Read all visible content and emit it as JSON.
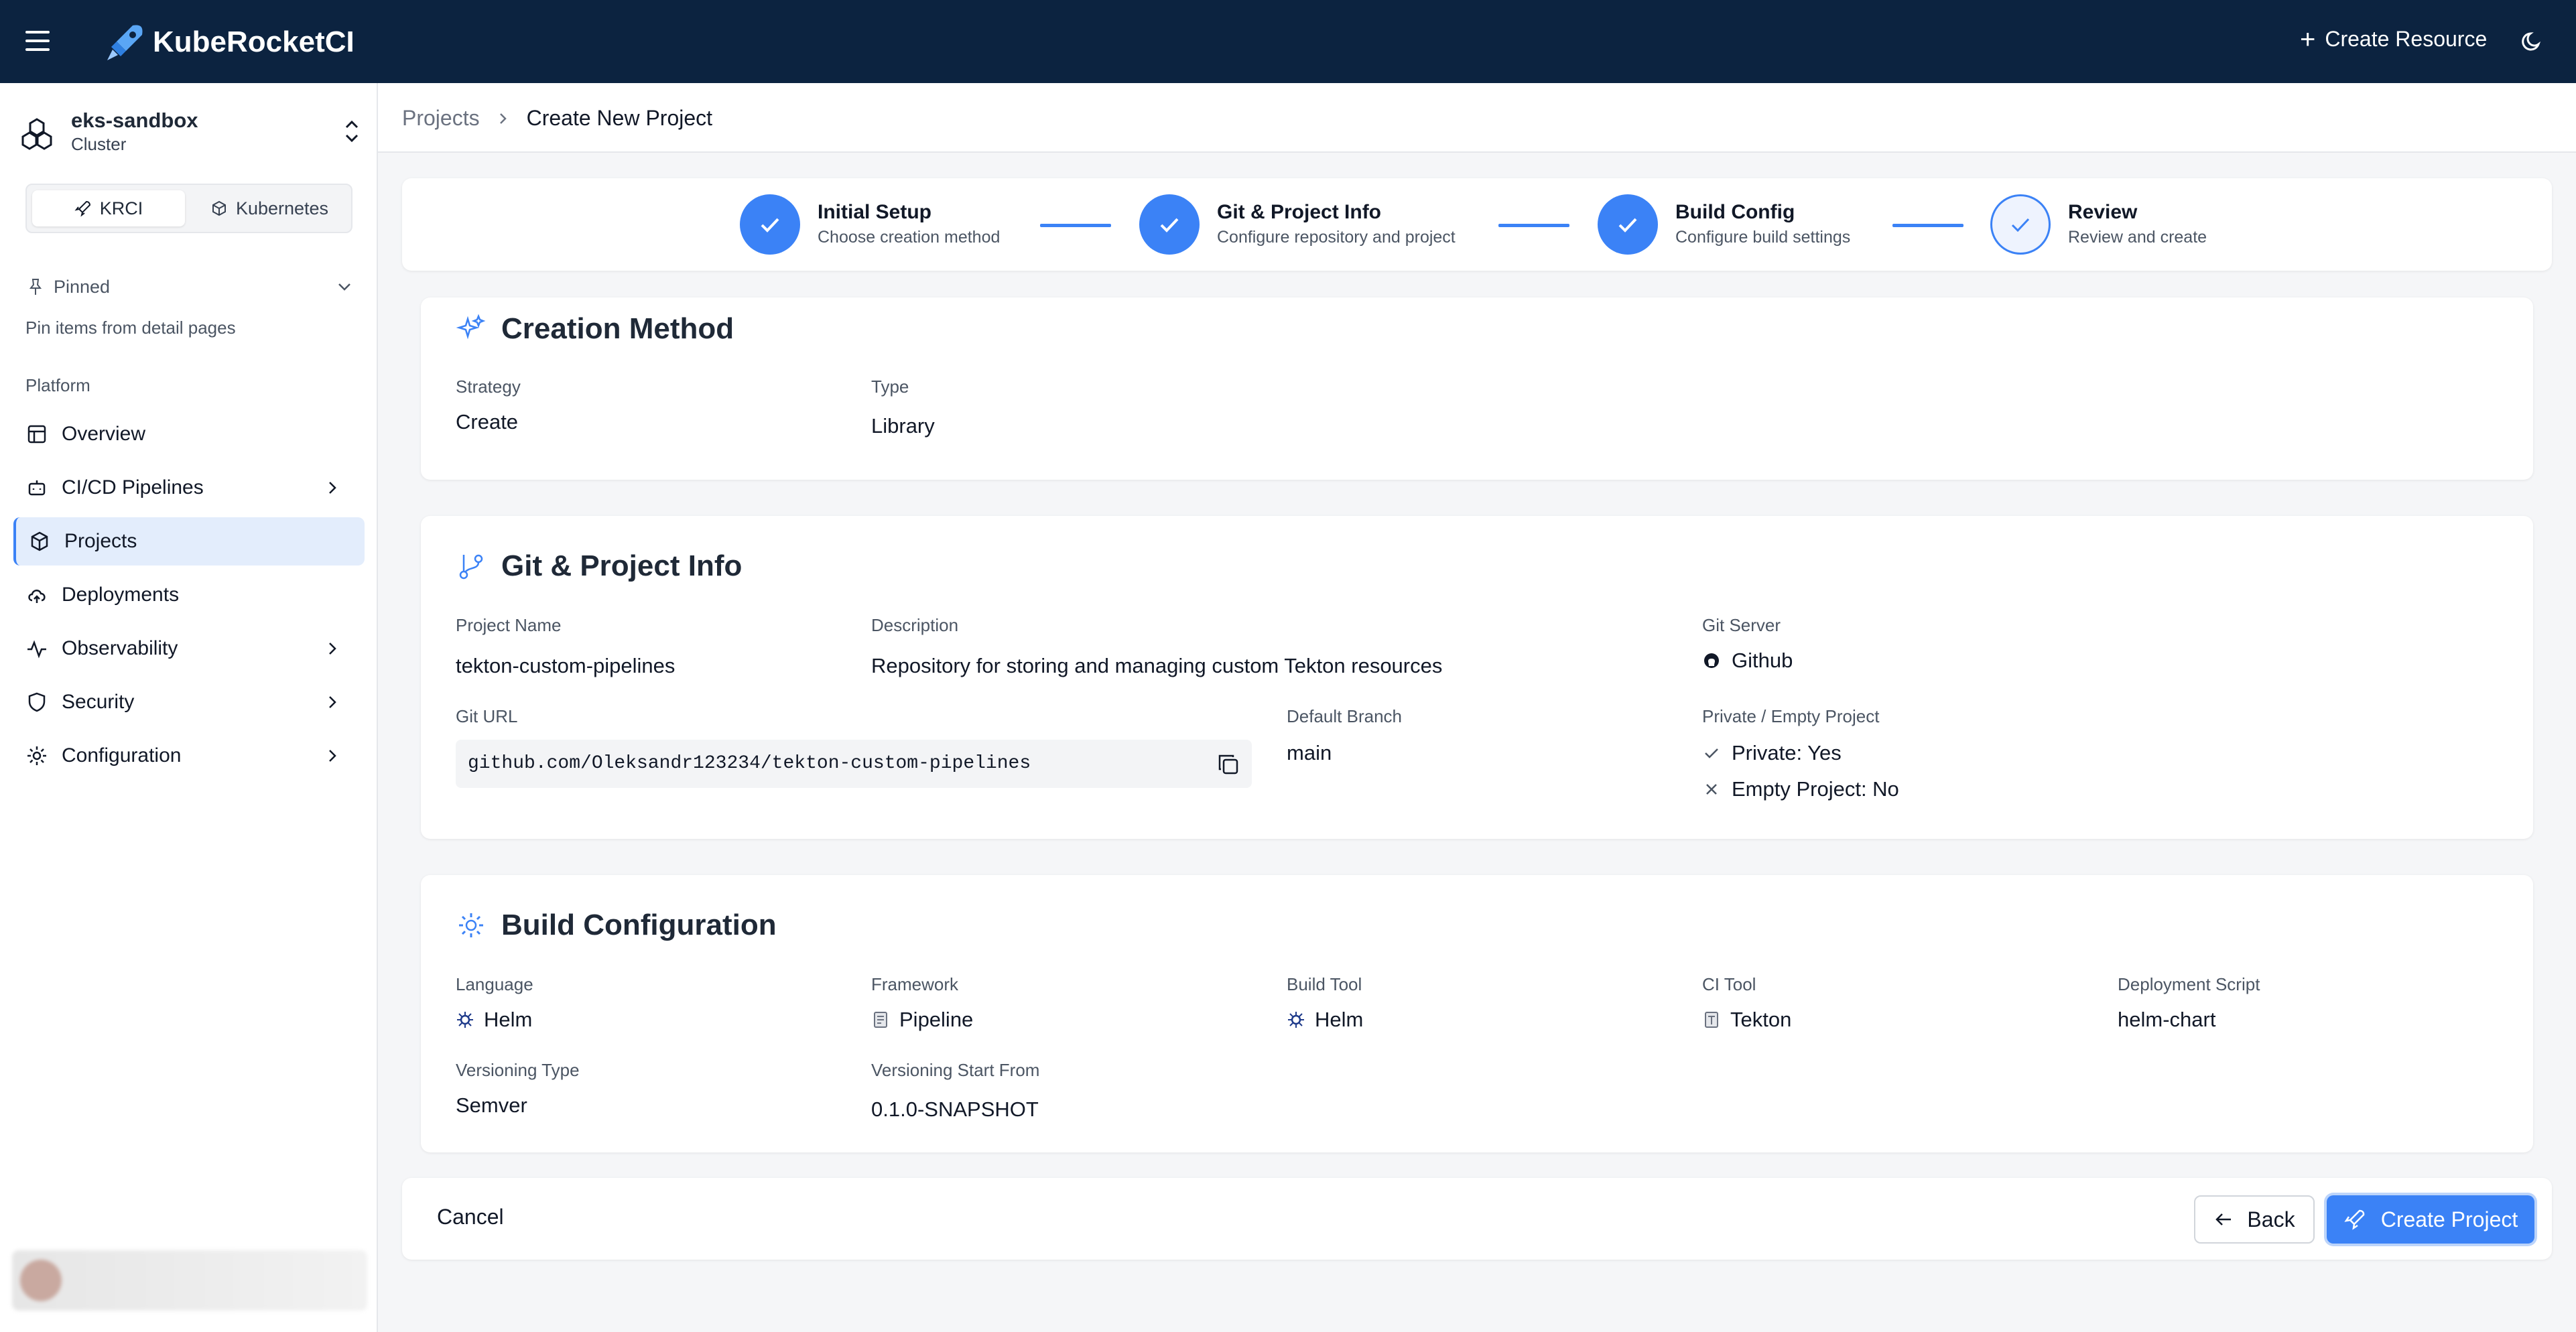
{
  "topbar": {
    "brand": "KubeRocketCI",
    "create_resource": "Create Resource",
    "icons": [
      "menu-icon",
      "rocket-logo-icon",
      "plus-icon",
      "moon-icon"
    ]
  },
  "sidebar": {
    "cluster_name": "eks-sandbox",
    "cluster_sub": "Cluster",
    "tabs": [
      {
        "label": "KRCI",
        "active": true
      },
      {
        "label": "Kubernetes",
        "active": false
      }
    ],
    "pinned_label": "Pinned",
    "pinned_hint": "Pin items from detail pages",
    "section": "Platform",
    "items": [
      {
        "label": "Overview",
        "icon": "layout-icon",
        "has_children": false,
        "active": false
      },
      {
        "label": "CI/CD Pipelines",
        "icon": "bot-icon",
        "has_children": true,
        "active": false
      },
      {
        "label": "Projects",
        "icon": "box-icon",
        "has_children": false,
        "active": true
      },
      {
        "label": "Deployments",
        "icon": "cloud-upload-icon",
        "has_children": false,
        "active": false
      },
      {
        "label": "Observability",
        "icon": "activity-icon",
        "has_children": true,
        "active": false
      },
      {
        "label": "Security",
        "icon": "shield-icon",
        "has_children": true,
        "active": false
      },
      {
        "label": "Configuration",
        "icon": "gear-icon",
        "has_children": true,
        "active": false
      }
    ]
  },
  "breadcrumb": {
    "parent": "Projects",
    "current": "Create New Project"
  },
  "stepper": {
    "steps": [
      {
        "title": "Initial Setup",
        "subtitle": "Choose creation method",
        "state": "complete"
      },
      {
        "title": "Git & Project Info",
        "subtitle": "Configure repository and project",
        "state": "complete"
      },
      {
        "title": "Build Config",
        "subtitle": "Configure build settings",
        "state": "complete"
      },
      {
        "title": "Review",
        "subtitle": "Review and create",
        "state": "current"
      }
    ]
  },
  "creation_method": {
    "title": "Creation Method",
    "strategy_label": "Strategy",
    "strategy_value": "Create",
    "type_label": "Type",
    "type_value": "Library"
  },
  "git_info": {
    "title": "Git & Project Info",
    "project_name_label": "Project Name",
    "project_name_value": "tekton-custom-pipelines",
    "description_label": "Description",
    "description_value": "Repository for storing and managing custom Tekton resources",
    "git_server_label": "Git Server",
    "git_server_value": "Github",
    "git_url_label": "Git URL",
    "git_url_value": "github.com/Oleksandr123234/tekton-custom-pipelines",
    "default_branch_label": "Default Branch",
    "default_branch_value": "main",
    "private_label": "Private / Empty Project",
    "private_value": "Private: Yes",
    "empty_value": "Empty Project: No"
  },
  "build_config": {
    "title": "Build Configuration",
    "language_label": "Language",
    "language_value": "Helm",
    "framework_label": "Framework",
    "framework_value": "Pipeline",
    "build_tool_label": "Build Tool",
    "build_tool_value": "Helm",
    "ci_tool_label": "CI Tool",
    "ci_tool_value": "Tekton",
    "deployment_script_label": "Deployment Script",
    "deployment_script_value": "helm-chart",
    "versioning_type_label": "Versioning Type",
    "versioning_type_value": "Semver",
    "versioning_start_label": "Versioning Start From",
    "versioning_start_value": "0.1.0-SNAPSHOT"
  },
  "footer": {
    "cancel": "Cancel",
    "back": "Back",
    "create": "Create Project"
  },
  "colors": {
    "topbar": "#0c2340",
    "accent": "#3b82f6",
    "active_nav_bg": "#e3edfc"
  }
}
